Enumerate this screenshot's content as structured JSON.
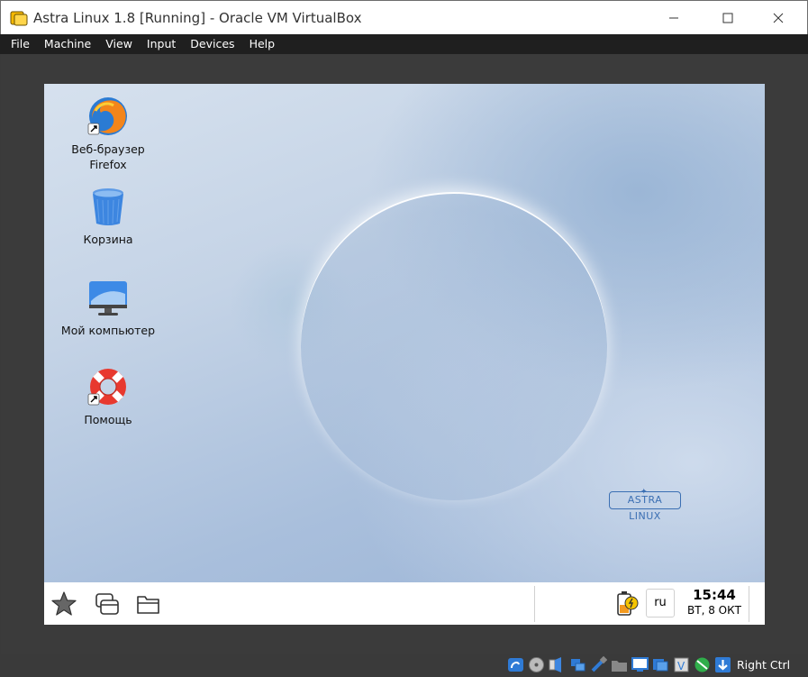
{
  "window": {
    "title": "Astra Linux 1.8 [Running] - Oracle VM VirtualBox"
  },
  "menubar": {
    "items": [
      "File",
      "Machine",
      "View",
      "Input",
      "Devices",
      "Help"
    ]
  },
  "desktop": {
    "icons": [
      {
        "label_line1": "Веб-браузер",
        "label_line2": "Firefox",
        "icon": "firefox-icon"
      },
      {
        "label_line1": "Корзина",
        "icon": "trash-icon"
      },
      {
        "label_line1": "Мой компьютер",
        "icon": "computer-icon"
      },
      {
        "label_line1": "Помощь",
        "icon": "help-lifebuoy-icon"
      }
    ],
    "brand_text": "ASTRA LINUX"
  },
  "taskbar": {
    "language": "ru",
    "time": "15:44",
    "date": "ВТ, 8 ОКТ"
  },
  "statusbar": {
    "host_key": "Right Ctrl"
  },
  "colors": {
    "menubar_bg": "#1f1f1f",
    "vm_frame_bg": "#3b3b3b",
    "brand_blue": "#3b6fb3"
  }
}
